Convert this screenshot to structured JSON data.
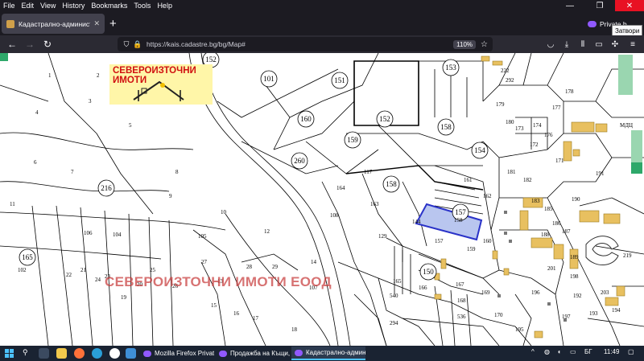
{
  "menu": [
    "File",
    "Edit",
    "View",
    "History",
    "Bookmarks",
    "Tools",
    "Help"
  ],
  "window": {
    "minimize": "—",
    "restore": "❐",
    "close": "✕"
  },
  "tab": {
    "title": "Кадастрално-административ",
    "close": "✕"
  },
  "newtab": "+",
  "private_label": "Private b",
  "tooltip": "Затвори",
  "nav": {
    "back": "←",
    "forward": "→",
    "reload": "↻"
  },
  "url": "https://kais.cadastre.bg/bg/Map#",
  "zoom": "110%",
  "logo": {
    "text": "СЕВЕРОИЗТОЧНИ ИМОТИ"
  },
  "watermark": "СЕВЕРОИЗТОЧНИ ИМОТИ ЕООД",
  "map": {
    "circled": [
      "152",
      "101",
      "151",
      "153",
      "159",
      "160",
      "152",
      "158",
      "154",
      "260",
      "216",
      "158",
      "157",
      "150",
      "165"
    ],
    "numbers": [
      "1",
      "2",
      "3",
      "4",
      "5",
      "6",
      "7",
      "8",
      "9",
      "10",
      "11",
      "12",
      "13",
      "14",
      "15",
      "16",
      "17",
      "18",
      "19",
      "20",
      "21",
      "22",
      "23",
      "24",
      "25",
      "26",
      "27",
      "28",
      "29",
      "102",
      "104",
      "105",
      "106",
      "107",
      "108",
      "117",
      "129",
      "144",
      "157",
      "158",
      "159",
      "160",
      "161",
      "162",
      "163",
      "164",
      "165",
      "166",
      "167",
      "168",
      "169",
      "170",
      "171",
      "172",
      "173",
      "174",
      "176",
      "177",
      "178",
      "179",
      "180",
      "181",
      "182",
      "183",
      "185",
      "186",
      "187",
      "188",
      "189",
      "190",
      "191",
      "192",
      "193",
      "194",
      "195",
      "196",
      "197",
      "198",
      "201",
      "203",
      "219",
      "222",
      "292",
      "294",
      "536",
      "540",
      "МДЦ"
    ]
  },
  "taskbar": {
    "apps": [
      "Mozilla Firefox Privat...",
      "Продажба на Къщи, ...",
      "Кадастрално-админ..."
    ],
    "lang": "БГ",
    "time": "11:49"
  }
}
